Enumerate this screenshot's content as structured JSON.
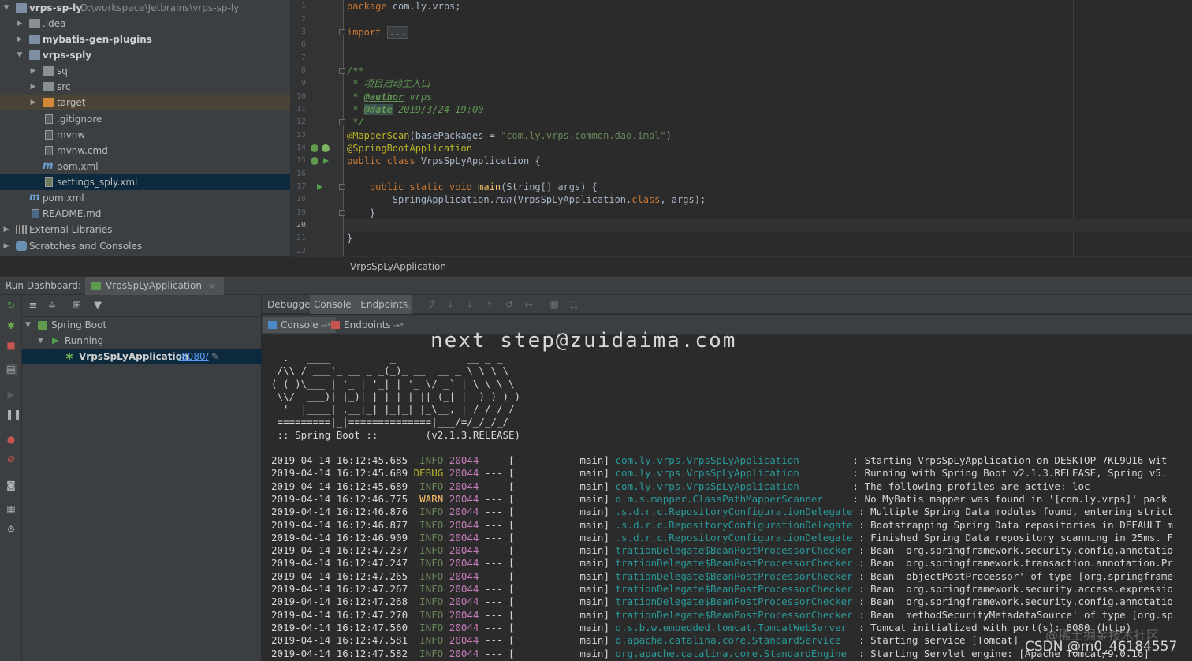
{
  "project_tree": [
    {
      "label": "vrps-sp-ly",
      "path": "D:\\workspace\\Jetbrains\\vrps-sp-ly",
      "expanded": true,
      "icon": "module-folder-icon"
    },
    {
      "label": ".idea",
      "icon": "folder-icon"
    },
    {
      "label": "mybatis-gen-plugins",
      "icon": "module-folder-icon"
    },
    {
      "label": "vrps-sply",
      "icon": "module-folder-icon",
      "expanded": true
    },
    {
      "label": "sql",
      "icon": "folder-icon"
    },
    {
      "label": "src",
      "icon": "folder-icon"
    },
    {
      "label": "target",
      "icon": "excluded-folder-icon"
    },
    {
      "label": ".gitignore",
      "icon": "file-icon"
    },
    {
      "label": "mvnw",
      "icon": "file-icon"
    },
    {
      "label": "mvnw.cmd",
      "icon": "file-icon"
    },
    {
      "label": "pom.xml",
      "icon": "maven-icon"
    },
    {
      "label": "settings_sply.xml",
      "icon": "xml-file-icon",
      "selected": true
    },
    {
      "label": "pom.xml",
      "icon": "maven-icon"
    },
    {
      "label": "README.md",
      "icon": "markdown-icon"
    },
    {
      "label": "External Libraries",
      "icon": "libraries-icon"
    },
    {
      "label": "Scratches and Consoles",
      "icon": "scratches-icon"
    }
  ],
  "editor": {
    "line_numbers": [
      "1",
      "2",
      "3",
      "6",
      "7",
      "8",
      "9",
      "10",
      "11",
      "12",
      "13",
      "14",
      "15",
      "16",
      "17",
      "18",
      "19",
      "20",
      "21",
      "22"
    ],
    "code": {
      "pkg_kw": "package",
      "pkg_name": " com.ly.vrps;",
      "import_kw": "import",
      "import_collapsed": "...",
      "doc_open": "/**",
      "doc_desc": " * 项目启动主入口",
      "doc_author_prefix": " * ",
      "doc_author_tag": "@author",
      "doc_author_val": " vrps",
      "doc_date_prefix": " * ",
      "doc_date_tag": "@date",
      "doc_date_val": " 2019/3/24 19:00",
      "doc_close": " */",
      "mapper_ann": "@MapperScan",
      "mapper_args_open": "(basePackages = ",
      "mapper_str": "\"com.ly.vrps.common.dao.impl\"",
      "mapper_close": ")",
      "boot_ann": "@SpringBootApplication",
      "class_kw": "public class",
      "class_name": " VrpsSpLyApplication {",
      "main_kw": "    public static void",
      "main_fn": " main",
      "main_args": "(String[] args) {",
      "run_indent": "        SpringApplication.",
      "run_fn": "run",
      "run_args_open": "(VrpsSpLyApplication.",
      "run_class_kw": "class",
      "run_args_close": ", args);",
      "close_inner": "    }",
      "close_outer": "}"
    },
    "breadcrumb": "VrpsSpLyApplication"
  },
  "run_dashboard": {
    "title": "Run Dashboard:",
    "tab_label": "VrpsSpLyApplication",
    "tab_close": "×"
  },
  "services": {
    "spring_boot": "Spring Boot",
    "running": "Running",
    "app_name": "VrpsSpLyApplication",
    "app_port": ":8080/"
  },
  "console": {
    "tabs": {
      "debugger": "Debugger",
      "console_endpoints": "Console | Endpoints"
    },
    "subtabs": {
      "console": "Console",
      "endpoints": "Endpoints",
      "pin": "→*"
    },
    "watermark": "next step@zuidaima.com",
    "banner": [
      "  .   ____          _            __ _ _",
      " /\\\\ / ___'_ __ _ _(_)_ __  __ _ \\ \\ \\ \\",
      "( ( )\\___ | '_ | '_| | '_ \\/ _` | \\ \\ \\ \\",
      " \\\\/  ___)| |_)| | | | | || (_| |  ) ) ) )",
      "  '  |____| .__|_| |_|_| |_\\__, | / / / /",
      " =========|_|==============|___/=/_/_/_/",
      " :: Spring Boot ::        (v2.1.3.RELEASE)"
    ],
    "logs": [
      {
        "ts": "2019-04-14 16:12:45.685",
        "level": " INFO",
        "pid": "20044",
        "thread": "main",
        "logger": "com.ly.vrps.VrpsSpLyApplication        ",
        "msg": ": Starting VrpsSpLyApplication on DESKTOP-7KL9U16 wit"
      },
      {
        "ts": "2019-04-14 16:12:45.689",
        "level": "DEBUG",
        "pid": "20044",
        "thread": "main",
        "logger": "com.ly.vrps.VrpsSpLyApplication        ",
        "msg": ": Running with Spring Boot v2.1.3.RELEASE, Spring v5."
      },
      {
        "ts": "2019-04-14 16:12:45.689",
        "level": " INFO",
        "pid": "20044",
        "thread": "main",
        "logger": "com.ly.vrps.VrpsSpLyApplication        ",
        "msg": ": The following profiles are active: loc"
      },
      {
        "ts": "2019-04-14 16:12:46.775",
        "level": " WARN",
        "pid": "20044",
        "thread": "main",
        "logger": "o.m.s.mapper.ClassPathMapperScanner    ",
        "msg": ": No MyBatis mapper was found in '[com.ly.vrps]' pack"
      },
      {
        "ts": "2019-04-14 16:12:46.876",
        "level": " INFO",
        "pid": "20044",
        "thread": "main",
        "logger": ".s.d.r.c.RepositoryConfigurationDelegate",
        "msg": ": Multiple Spring Data modules found, entering strict"
      },
      {
        "ts": "2019-04-14 16:12:46.877",
        "level": " INFO",
        "pid": "20044",
        "thread": "main",
        "logger": ".s.d.r.c.RepositoryConfigurationDelegate",
        "msg": ": Bootstrapping Spring Data repositories in DEFAULT m"
      },
      {
        "ts": "2019-04-14 16:12:46.909",
        "level": " INFO",
        "pid": "20044",
        "thread": "main",
        "logger": ".s.d.r.c.RepositoryConfigurationDelegate",
        "msg": ": Finished Spring Data repository scanning in 25ms. F"
      },
      {
        "ts": "2019-04-14 16:12:47.237",
        "level": " INFO",
        "pid": "20044",
        "thread": "main",
        "logger": "trationDelegate$BeanPostProcessorChecker",
        "msg": ": Bean 'org.springframework.security.config.annotatio"
      },
      {
        "ts": "2019-04-14 16:12:47.247",
        "level": " INFO",
        "pid": "20044",
        "thread": "main",
        "logger": "trationDelegate$BeanPostProcessorChecker",
        "msg": ": Bean 'org.springframework.transaction.annotation.Pr"
      },
      {
        "ts": "2019-04-14 16:12:47.265",
        "level": " INFO",
        "pid": "20044",
        "thread": "main",
        "logger": "trationDelegate$BeanPostProcessorChecker",
        "msg": ": Bean 'objectPostProcessor' of type [org.springframe"
      },
      {
        "ts": "2019-04-14 16:12:47.267",
        "level": " INFO",
        "pid": "20044",
        "thread": "main",
        "logger": "trationDelegate$BeanPostProcessorChecker",
        "msg": ": Bean 'org.springframework.security.access.expressio"
      },
      {
        "ts": "2019-04-14 16:12:47.268",
        "level": " INFO",
        "pid": "20044",
        "thread": "main",
        "logger": "trationDelegate$BeanPostProcessorChecker",
        "msg": ": Bean 'org.springframework.security.config.annotatio"
      },
      {
        "ts": "2019-04-14 16:12:47.270",
        "level": " INFO",
        "pid": "20044",
        "thread": "main",
        "logger": "trationDelegate$BeanPostProcessorChecker",
        "msg": ": Bean 'methodSecurityMetadataSource' of type [org.sp"
      },
      {
        "ts": "2019-04-14 16:12:47.560",
        "level": " INFO",
        "pid": "20044",
        "thread": "main",
        "logger": "o.s.b.w.embedded.tomcat.TomcatWebServer ",
        "msg": ": Tomcat initialized with port(s): 8080 (http)"
      },
      {
        "ts": "2019-04-14 16:12:47.581",
        "level": " INFO",
        "pid": "20044",
        "thread": "main",
        "logger": "o.apache.catalina.core.StandardService  ",
        "msg": ": Starting service [Tomcat]"
      },
      {
        "ts": "2019-04-14 16:12:47.582",
        "level": " INFO",
        "pid": "20044",
        "thread": "main",
        "logger": "org.apache.catalina.core.StandardEngine ",
        "msg": ": Starting Servlet engine: [Apache Tomcat/9.0.16]"
      }
    ]
  },
  "watermarks": {
    "juejin": "@稀土掘金技术社区",
    "csdn": "CSDN @m0_46184557"
  },
  "colors": {
    "bg_dark": "#2b2b2b",
    "bg_panel": "#3c3f41",
    "selection": "#0d293e",
    "keyword": "#cc7832",
    "annotation": "#bbb529",
    "string": "#6a8759",
    "logger": "#299999"
  }
}
